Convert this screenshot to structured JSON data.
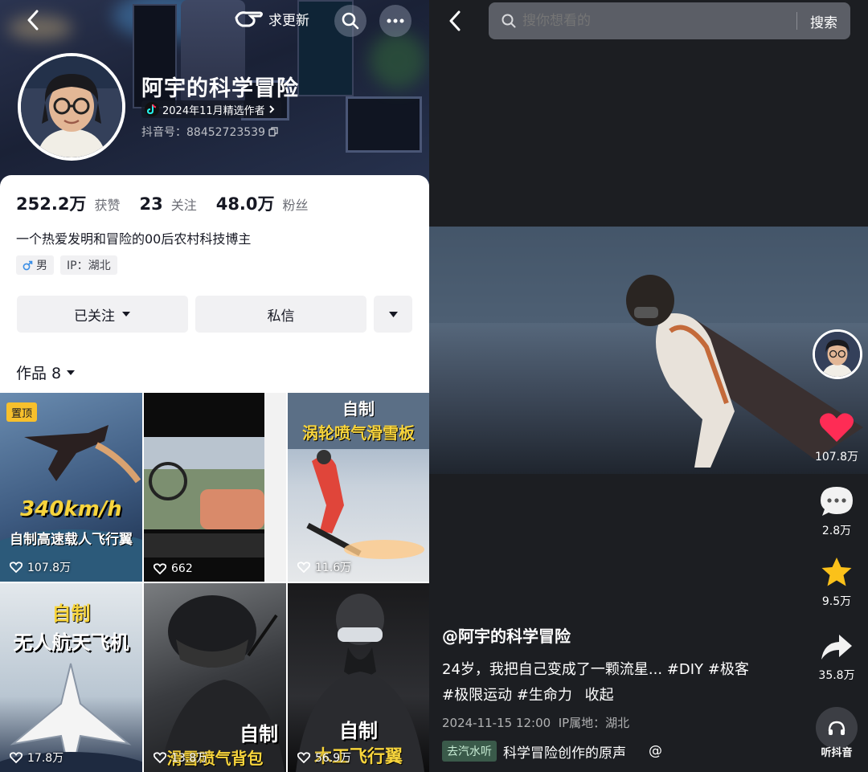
{
  "left": {
    "header": {
      "update_label": "求更新",
      "title": "阿宇的科学冒险",
      "badge": "2024年11月精选作者",
      "douyin_id": "抖音号：88452723539"
    },
    "stats": [
      {
        "value": "252.2万",
        "label": "获赞"
      },
      {
        "value": "23",
        "label": "关注"
      },
      {
        "value": "48.0万",
        "label": "粉丝"
      }
    ],
    "bio": "一个热爱发明和冒险的00后农村科技博主",
    "tags": {
      "gender": "男",
      "ip": "IP：湖北"
    },
    "actions": {
      "follow": "已关注",
      "message": "私信"
    },
    "works_label": "作品 8",
    "grid": [
      {
        "pinned": "置顶",
        "line1": "340km/h",
        "line2": "自制高速载人飞行翼",
        "likes": "107.8万"
      },
      {
        "likes": "662"
      },
      {
        "line1": "自制",
        "line2": "涡轮喷气滑雪板",
        "likes": "11.6万"
      },
      {
        "line1": "自制",
        "line2": "无人航天飞机",
        "likes": "17.8万"
      },
      {
        "line1": "自制",
        "line2": "滑雪喷气背包",
        "likes": "13.8万"
      },
      {
        "line1": "自制",
        "line2": "木工飞行翼",
        "likes": "56.9万"
      }
    ]
  },
  "right": {
    "search": {
      "placeholder": "搜你想看的",
      "button": "搜索"
    },
    "side": {
      "likes": "107.8万",
      "comments": "2.8万",
      "favorites": "9.5万",
      "shares": "35.8万",
      "listen": "听抖音"
    },
    "caption": {
      "author": "@阿宇的科学冒险",
      "line1": "24岁，我把自己变成了一颗流星... #DIY #极客",
      "line2": "#极限运动 #生命力",
      "collapse": "收起",
      "meta": "2024-11-15 12:00  IP属地：湖北",
      "music_tag": "去汽水听",
      "music": "科学冒险创作的原声",
      "at": "@"
    }
  },
  "colors": {
    "like": "#fe2c55",
    "star": "#fbc11a",
    "pin": "#f7c02c",
    "headline": "#f7d43c"
  }
}
